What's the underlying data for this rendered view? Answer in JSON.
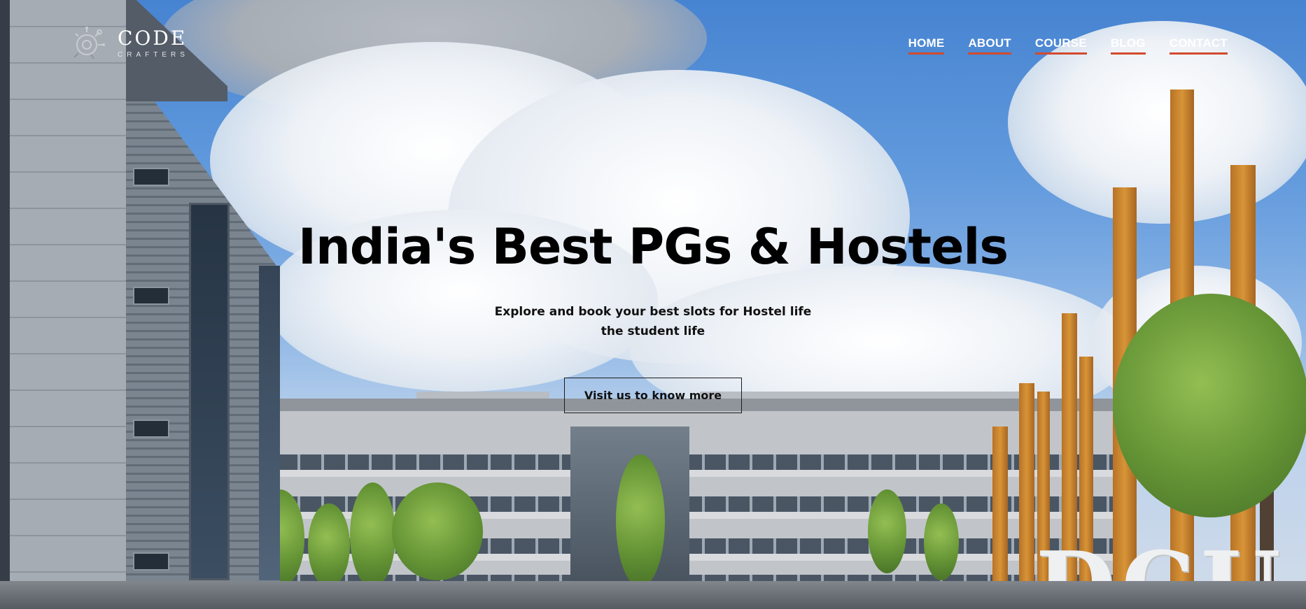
{
  "brand": {
    "name": "CODE",
    "subtitle": "CRAFTERS",
    "logo_icon": "gear-circuit-icon"
  },
  "nav": {
    "items": [
      {
        "label": "HOME"
      },
      {
        "label": "ABOUT"
      },
      {
        "label": "COURSE"
      },
      {
        "label": "BLOG"
      },
      {
        "label": "CONTACT"
      }
    ],
    "underline_color": "#d24a2d"
  },
  "hero": {
    "title": "India's Best PGs & Hostels",
    "tagline_line1": "Explore and book your best slots for Hostel life",
    "tagline_line2": "the student life",
    "cta_label": "Visit us to know more"
  },
  "background": {
    "sign_text": "DCU"
  }
}
